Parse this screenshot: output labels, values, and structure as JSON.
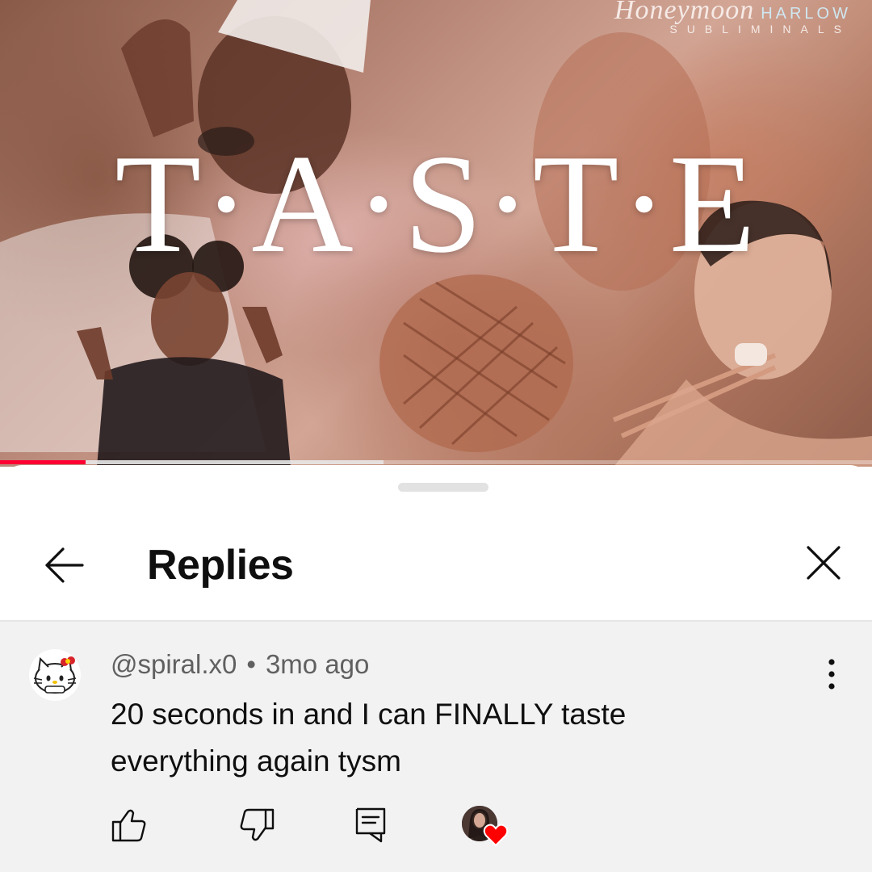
{
  "video": {
    "brand_script": "Honeymoon",
    "brand_name": "HARLOW",
    "brand_sub": "SUBLIMINALS",
    "title": "T·A·S·T·E",
    "progress_played_fraction": 0.098,
    "progress_buffered_fraction": 0.44
  },
  "sheet": {
    "title": "Replies"
  },
  "comment": {
    "author": "@spiral.x0",
    "separator": "•",
    "time": "3mo ago",
    "text": "20 seconds in and I can FINALLY taste everything again tysm"
  },
  "colors": {
    "progress": "#ff0033",
    "heart": "#ff0000",
    "text_primary": "#0f0f0f",
    "text_secondary": "#606060",
    "comment_bg": "#f2f2f2"
  },
  "icons": {
    "back": "arrow-left-icon",
    "close": "close-icon",
    "more": "more-vertical-icon",
    "like": "thumbs-up-icon",
    "dislike": "thumbs-down-icon",
    "reply": "comment-icon",
    "creator_heart": "heart-icon"
  }
}
